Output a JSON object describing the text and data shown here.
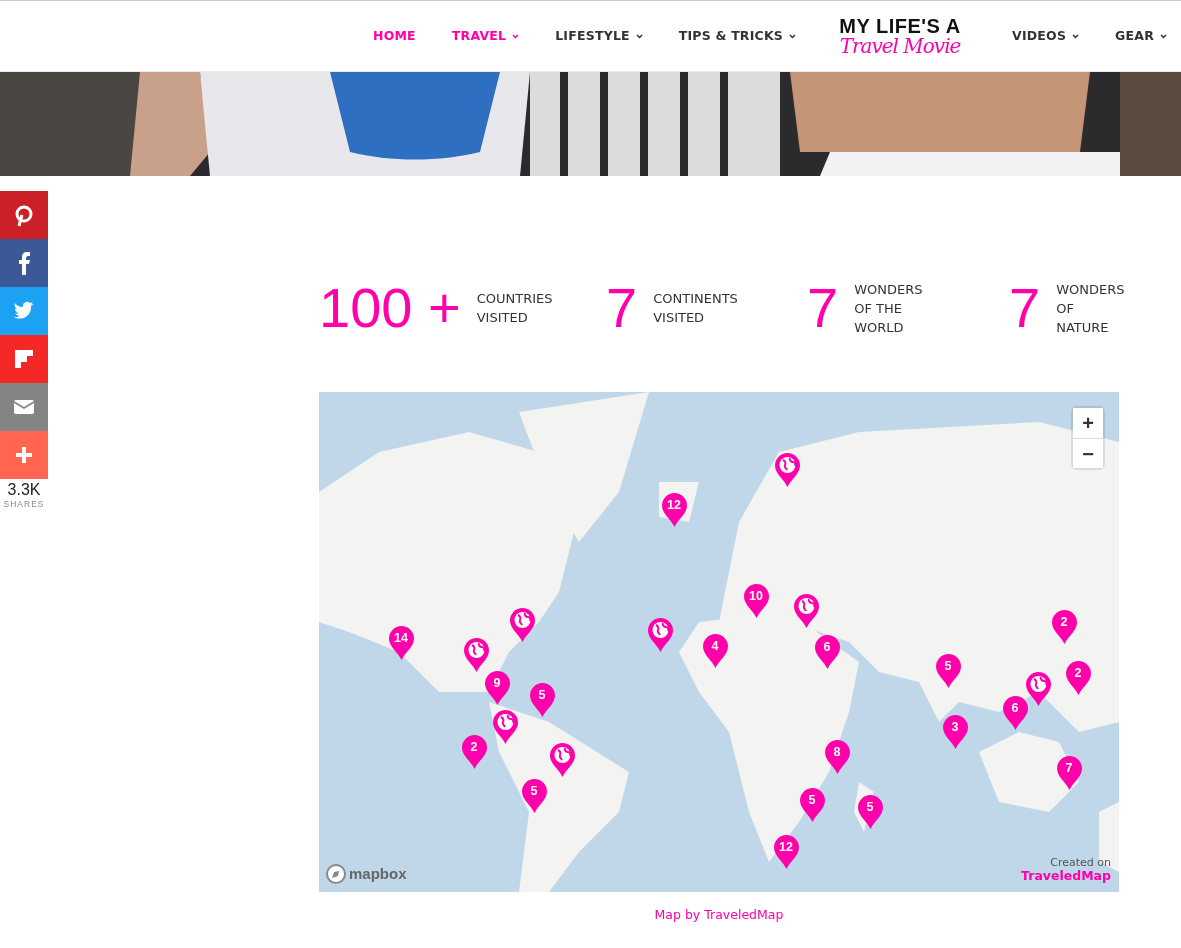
{
  "nav": {
    "left": [
      {
        "label": "HOME",
        "selected": true,
        "dropdown": false
      },
      {
        "label": "TRAVEL",
        "selected": true,
        "dropdown": true
      },
      {
        "label": "LIFESTYLE",
        "selected": false,
        "dropdown": true
      },
      {
        "label": "TIPS & TRICKS",
        "selected": false,
        "dropdown": true
      }
    ],
    "logo": {
      "line1": "MY LIFE'S A",
      "line2": "Travel Movie"
    },
    "right": [
      {
        "label": "VIDEOS",
        "selected": false,
        "dropdown": true
      },
      {
        "label": "GEAR",
        "selected": false,
        "dropdown": true
      }
    ]
  },
  "share": {
    "buttons": [
      {
        "kind": "pinterest"
      },
      {
        "kind": "facebook"
      },
      {
        "kind": "twitter"
      },
      {
        "kind": "flipboard"
      },
      {
        "kind": "email"
      },
      {
        "kind": "more"
      }
    ],
    "count": "3.3K",
    "count_label": "SHARES"
  },
  "stats": [
    {
      "number": "100",
      "suffix": "+",
      "label": "COUNTRIES\nVISITED"
    },
    {
      "number": "7",
      "label": "CONTINENTS\nVISITED"
    },
    {
      "number": "7",
      "label": "WONDERS\nOF THE\nWORLD"
    },
    {
      "number": "7",
      "label": "WONDERS\nOF\nNATURE"
    }
  ],
  "map": {
    "markers": [
      {
        "kind": "globe"
      },
      {
        "kind": "count",
        "label": "12"
      },
      {
        "kind": "count",
        "label": "10"
      },
      {
        "kind": "globe"
      },
      {
        "kind": "globe"
      },
      {
        "kind": "globe"
      },
      {
        "kind": "count",
        "label": "14"
      },
      {
        "kind": "globe"
      },
      {
        "kind": "count",
        "label": "4"
      },
      {
        "kind": "count",
        "label": "6"
      },
      {
        "kind": "count",
        "label": "2"
      },
      {
        "kind": "count",
        "label": "5"
      },
      {
        "kind": "count",
        "label": "2"
      },
      {
        "kind": "count",
        "label": "9"
      },
      {
        "kind": "count",
        "label": "5"
      },
      {
        "kind": "globe"
      },
      {
        "kind": "count",
        "label": "6"
      },
      {
        "kind": "globe"
      },
      {
        "kind": "count",
        "label": "3"
      },
      {
        "kind": "count",
        "label": "2"
      },
      {
        "kind": "globe"
      },
      {
        "kind": "count",
        "label": "8"
      },
      {
        "kind": "count",
        "label": "7"
      },
      {
        "kind": "count",
        "label": "5"
      },
      {
        "kind": "count",
        "label": "5"
      },
      {
        "kind": "count",
        "label": "5"
      },
      {
        "kind": "count",
        "label": "12"
      }
    ],
    "zoom_in": "+",
    "zoom_out": "−",
    "provider": "mapbox",
    "created_on": "Created on",
    "creator": "TraveledMap"
  },
  "caption": "Map by TraveledMap"
}
